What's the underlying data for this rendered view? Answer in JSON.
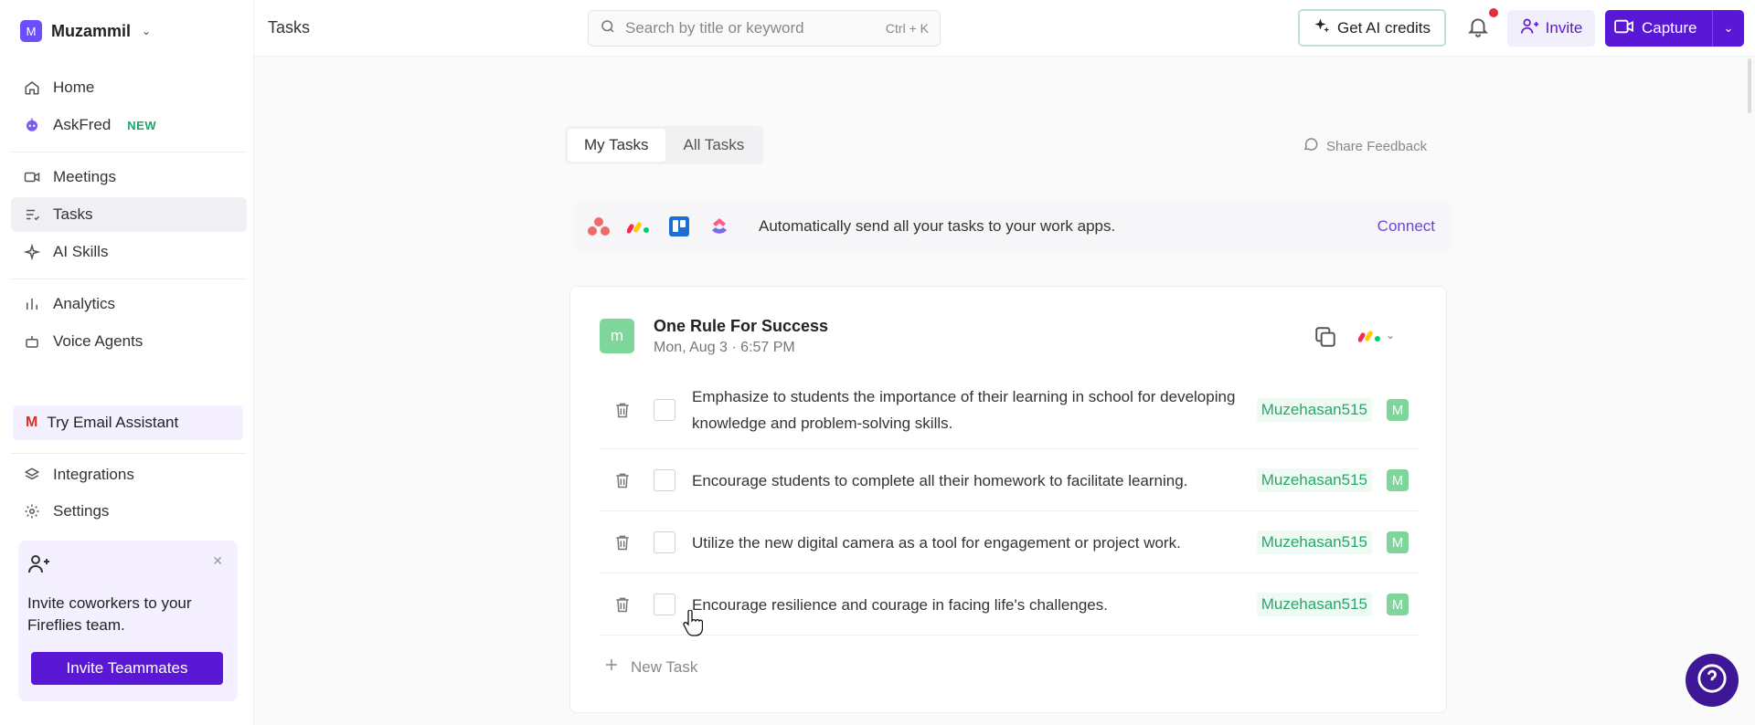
{
  "workspace": {
    "initial": "M",
    "name": "Muzammil"
  },
  "sidebar": {
    "items": [
      {
        "label": "Home"
      },
      {
        "label": "AskFred",
        "badge": "NEW"
      },
      {
        "label": "Meetings"
      },
      {
        "label": "Tasks"
      },
      {
        "label": "AI Skills"
      },
      {
        "label": "Analytics"
      },
      {
        "label": "Voice Agents"
      },
      {
        "label": "Integrations"
      },
      {
        "label": "Settings"
      }
    ],
    "email_assistant": "Try Email Assistant",
    "invite_card": {
      "text": "Invite coworkers to your Fireflies team.",
      "button": "Invite Teammates"
    }
  },
  "topbar": {
    "title": "Tasks",
    "search_placeholder": "Search by title or keyword",
    "search_shortcut": "Ctrl + K",
    "ai_credits": "Get AI credits",
    "invite": "Invite",
    "capture": "Capture"
  },
  "main": {
    "tabs": [
      {
        "label": "My Tasks",
        "active": true
      },
      {
        "label": "All Tasks",
        "active": false
      }
    ],
    "share_feedback": "Share Feedback",
    "banner": {
      "text": "Automatically send all your tasks to your work apps.",
      "connect": "Connect"
    },
    "meeting": {
      "initial": "m",
      "title": "One Rule For Success",
      "date": "Mon, Aug 3 · 6:57 PM",
      "tasks": [
        {
          "text": "Emphasize to students the importance of their learning in school for developing knowledge and problem-solving skills.",
          "assignee": "Muzehasan515",
          "assignee_initial": "M"
        },
        {
          "text": "Encourage students to complete all their homework to facilitate learning.",
          "assignee": "Muzehasan515",
          "assignee_initial": "M"
        },
        {
          "text": "Utilize the new digital camera as a tool for engagement or project work.",
          "assignee": "Muzehasan515",
          "assignee_initial": "M"
        },
        {
          "text": "Encourage resilience and courage in facing life's challenges.",
          "assignee": "Muzehasan515",
          "assignee_initial": "M"
        }
      ],
      "new_task": "New Task"
    }
  },
  "colors": {
    "accent": "#5b17d6",
    "assignee_green": "#27a86a",
    "avatar_green": "#7fd69b"
  }
}
